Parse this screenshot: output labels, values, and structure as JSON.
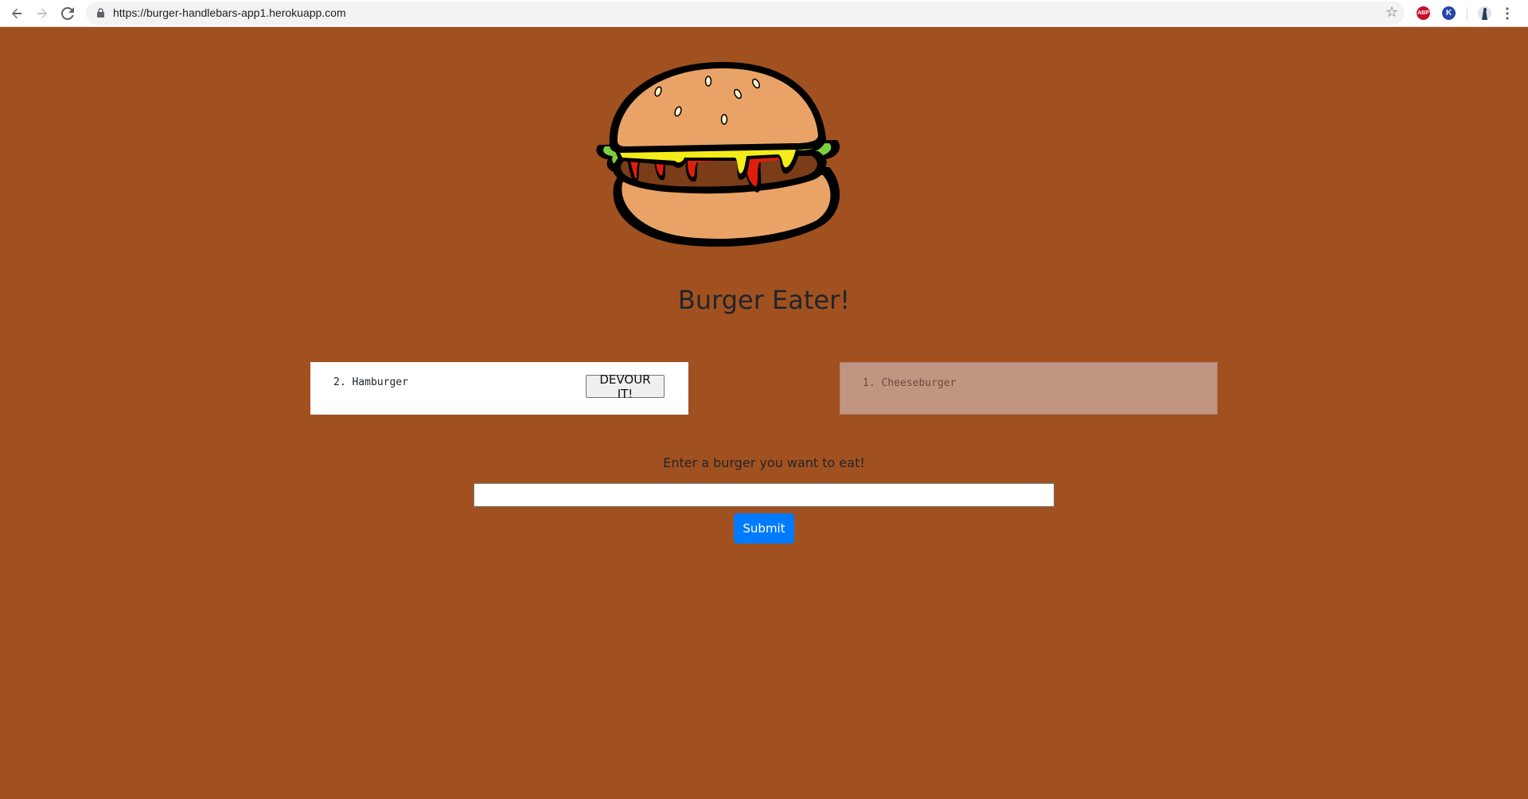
{
  "browser": {
    "url": "https://burger-handlebars-app1.herokuapp.com",
    "icons": {
      "back": "back-arrow-icon",
      "forward": "forward-arrow-icon",
      "reload": "reload-icon",
      "lock": "lock-icon",
      "bookmark": "star-icon",
      "menu": "more-vertical-icon"
    },
    "extensions": [
      {
        "name": "adblock-plus-extension-icon",
        "label": "ABP",
        "color": "#c70d2c"
      },
      {
        "name": "k-extension-icon",
        "label": "K",
        "color": "#2846a8"
      },
      {
        "name": "profile-avatar-icon",
        "label": "",
        "color": "#2b3a55"
      }
    ]
  },
  "page": {
    "background_color": "#a15120",
    "logo": "burger-illustration",
    "title": "Burger Eater!",
    "uneaten": {
      "items": [
        {
          "number": "2.",
          "name": "Hamburger",
          "button_label": "DEVOUR IT!"
        }
      ]
    },
    "devoured": {
      "items": [
        {
          "number": "1.",
          "name": "Cheeseburger"
        }
      ]
    },
    "form": {
      "prompt": "Enter a burger you want to eat!",
      "input_value": "",
      "input_placeholder": "",
      "submit_label": "Submit",
      "submit_color": "#007bff"
    }
  }
}
